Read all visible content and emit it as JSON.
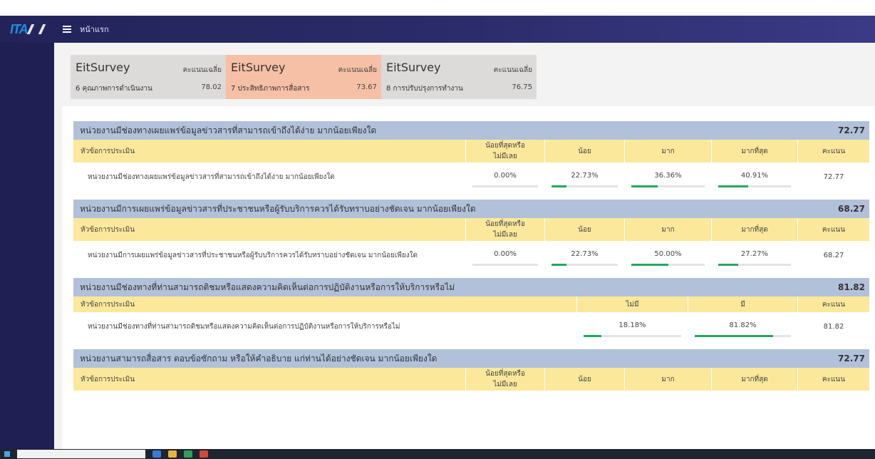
{
  "nav": {
    "logo": "ITA",
    "title": "หน้าแรก"
  },
  "colors": {
    "navbar": "#2b2b69",
    "sidebar": "#1f1f53",
    "section_header": "#b1c1da",
    "column_header": "#fce89b",
    "bar": "#28a75f",
    "card_gray": "#dddada",
    "card_peach": "#f6c0a6"
  },
  "cards": [
    {
      "name": "EitSurvey",
      "score_label": "คะแนนเฉลี่ย",
      "subtitle": "6 คุณภาพการดำเนินงาน",
      "value": "78.02",
      "style": "gray"
    },
    {
      "name": "EitSurvey",
      "score_label": "คะแนนเฉลี่ย",
      "subtitle": "7 ประสิทธิภาพการสื่อสาร",
      "value": "73.67",
      "style": "peach"
    },
    {
      "name": "EitSurvey",
      "score_label": "คะแนนเฉลี่ย",
      "subtitle": "8 การปรับปรุงการทำงาน",
      "value": "76.75",
      "style": "gray"
    }
  ],
  "sections": [
    {
      "title": "หน่วยงานมีช่องทางเผยแพร่ข้อมูลข่าวสารที่สามารถเข้าถึงได้ง่าย มากน้อยเพียงใด",
      "score": "72.77",
      "headers": [
        "หัวข้อการประเมิน",
        "น้อยที่สุดหรือไม่มีเลย",
        "น้อย",
        "มาก",
        "มากที่สุด",
        "คะแนน"
      ],
      "row": {
        "label": "หน่วยงานมีช่องทางเผยแพร่ข้อมูลข่าวสารที่สามารถเข้าถึงได้ง่าย มากน้อยเพียงใด",
        "values": [
          "0.00%",
          "22.73%",
          "36.36%",
          "40.91%"
        ],
        "fractions": [
          0,
          0.2273,
          0.3636,
          0.4091
        ],
        "score": "72.77"
      }
    },
    {
      "title": "หน่วยงานมีการเผยแพร่ข้อมูลข่าวสารที่ประชาชนหรือผู้รับบริการควรได้รับทราบอย่างชัดเจน มากน้อยเพียงใด",
      "score": "68.27",
      "headers": [
        "หัวข้อการประเมิน",
        "น้อยที่สุดหรือไม่มีเลย",
        "น้อย",
        "มาก",
        "มากที่สุด",
        "คะแนน"
      ],
      "row": {
        "label": "หน่วยงานมีการเผยแพร่ข้อมูลข่าวสารที่ประชาชนหรือผู้รับบริการควรได้รับทราบอย่างชัดเจน มากน้อยเพียงใด",
        "values": [
          "0.00%",
          "22.73%",
          "50.00%",
          "27.27%"
        ],
        "fractions": [
          0,
          0.2273,
          0.5,
          0.2727
        ],
        "score": "68.27"
      }
    },
    {
      "title": "หน่วยงานมีช่องทางที่ท่านสามารถติชมหรือแสดงความคิดเห็นต่อการปฏิบัติงานหรือการให้บริการหรือไม่",
      "score": "81.82",
      "headers": [
        "หัวข้อการประเมิน",
        "ไม่มี",
        "มี",
        "คะแนน"
      ],
      "row": {
        "label": "หน่วยงานมีช่องทางที่ท่านสามารถติชมหรือแสดงความคิดเห็นต่อการปฏิบัติงานหรือการให้บริการหรือไม่",
        "values": [
          "18.18%",
          "81.82%"
        ],
        "fractions": [
          0.1818,
          0.8182
        ],
        "score": "81.82"
      }
    },
    {
      "title": "หน่วยงานสามารถสื่อสาร ตอบข้อซักถาม หรือให้คำอธิบาย แก่ท่านได้อย่างชัดเจน มากน้อยเพียงใด",
      "score": "72.77",
      "headers": [
        "หัวข้อการประเมิน",
        "น้อยที่สุดหรือไม่มีเลย",
        "น้อย",
        "มาก",
        "มากที่สุด",
        "คะแนน"
      ]
    }
  ]
}
